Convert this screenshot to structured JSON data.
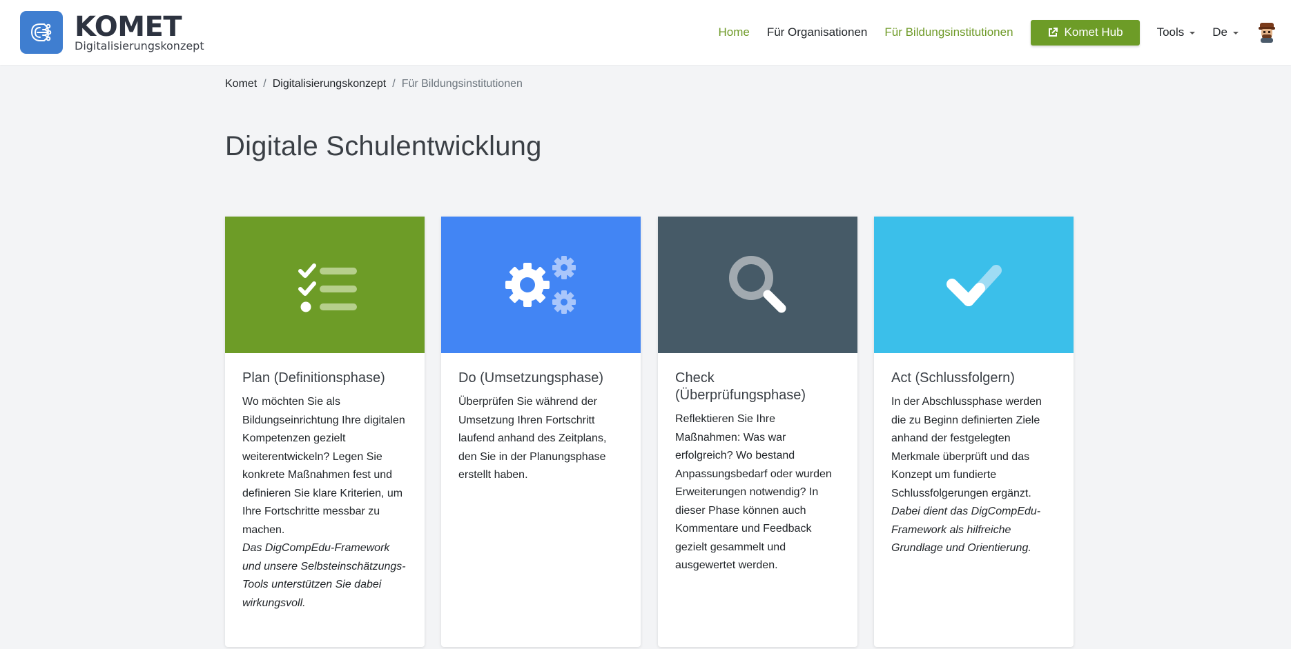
{
  "brand": {
    "title": "KOMET",
    "subtitle": "Digitalisierungskonzept"
  },
  "nav": {
    "home": "Home",
    "organisations": "Für Organisationen",
    "education": "Für Bildungsinstitutionen",
    "hub": "Komet Hub",
    "tools": "Tools",
    "language": "De"
  },
  "breadcrumb": {
    "item1": "Komet",
    "item2": "Digitalisierungskonzept",
    "item3": "Für Bildungsinstitutionen"
  },
  "page": {
    "title": "Digitale Schulentwicklung"
  },
  "cards": [
    {
      "title": "Plan (Definitionsphase)",
      "text": "Wo möchten Sie als Bildungseinrichtung Ihre digitalen Kompetenzen gezielt weiterentwickeln? Legen Sie konkrete Maßnahmen fest und definieren Sie klare Kriterien, um Ihre Fortschritte messbar zu machen.",
      "note": "Das DigCompEdu-Framework und unsere Selbsteinschätzungs-Tools unterstützen Sie dabei wirkungsvoll.",
      "color": "#6d9c27"
    },
    {
      "title": "Do (Umsetzungsphase)",
      "text": "Überprüfen Sie während der Umsetzung Ihren Fortschritt laufend anhand des Zeitplans, den Sie in der Planungsphase erstellt haben.",
      "note": "",
      "color": "#4285f4"
    },
    {
      "title": "Check (Überprüfungsphase)",
      "text": "Reflektieren Sie Ihre Maßnahmen: Was war erfolgreich? Wo bestand Anpassungsbedarf oder wurden Erweiterungen notwendig? In dieser Phase können auch Kommentare und Feedback gezielt gesammelt und ausgewertet werden.",
      "note": "",
      "color": "#465a67"
    },
    {
      "title": "Act (Schlussfolgern)",
      "text": "In der Abschlussphase werden die zu Beginn definierten Ziele anhand der festgelegten Merkmale überprüft und das Konzept um fundierte Schlussfolgerungen ergänzt.",
      "note": "Dabei dient das DigCompEdu-Framework als hilfreiche Grundlage und Orientierung.",
      "color": "#3bbfea"
    }
  ],
  "icons": {
    "card1": "checklist-icon",
    "card2": "gears-icon",
    "card3": "magnifier-icon",
    "card4": "checkmark-icon"
  }
}
